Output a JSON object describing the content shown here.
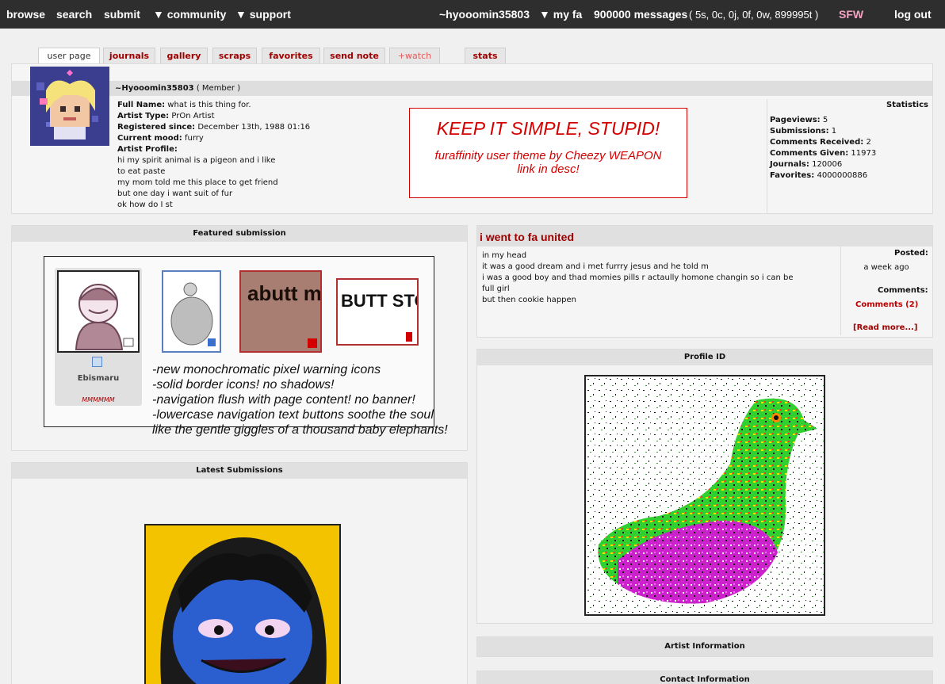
{
  "topnav": {
    "browse": "browse",
    "search": "search",
    "submit": "submit",
    "community": "▼ community",
    "support": "▼ support",
    "username": "~hyooomin35803",
    "myfa": "▼ my fa",
    "messages": "900000 messages",
    "message_counts": "( 5s, 0c, 0j, 0f, 0w, 899995t )",
    "sfw": "SFW",
    "logout": "log out"
  },
  "tabs": [
    {
      "label": "user page"
    },
    {
      "label": "journals"
    },
    {
      "label": "gallery"
    },
    {
      "label": "scraps"
    },
    {
      "label": "favorites"
    },
    {
      "label": "send note"
    },
    {
      "label": "+watch"
    },
    {
      "label": "stats"
    }
  ],
  "profile": {
    "name": "~Hyooomin35803",
    "role": "( Member )",
    "full_name_label": "Full Name:",
    "full_name": "what is this thing for.",
    "artist_type_label": "Artist Type:",
    "artist_type": "PrOn Artist",
    "registered_label": "Registered since:",
    "registered": "December 13th, 1988 01:16",
    "mood_label": "Current mood:",
    "mood": "furry",
    "artist_profile_label": "Artist Profile:",
    "bio": [
      "hi my spirit animal is a pigeon and i like",
      "to eat paste",
      "my mom told me this place to get friend",
      "but one day i want suit of fur",
      "ok how do I st"
    ]
  },
  "kiss_box": {
    "title": "KEEP IT SIMPLE, STUPID!",
    "line1": "furaffinity user theme by Cheezy WEAPON",
    "line2": "link in desc!"
  },
  "stats": {
    "heading": "Statistics",
    "items": [
      {
        "label": "Pageviews:",
        "value": "5"
      },
      {
        "label": "Submissions:",
        "value": "1"
      },
      {
        "label": "Comments Received:",
        "value": "2"
      },
      {
        "label": "Comments Given:",
        "value": "11973"
      },
      {
        "label": "Journals:",
        "value": "120006"
      },
      {
        "label": "Favorites:",
        "value": "4000000886"
      }
    ]
  },
  "featured": {
    "heading": "Featured submission",
    "artist": "Ebismaru",
    "rating_text": "MMMMMM",
    "notes": [
      "-new monochromatic pixel warning icons",
      "-solid border icons! no shadows!",
      "-navigation flush with page content! no banner!",
      "-lowercase navigation text buttons soothe the soul",
      "like the gentle giggles of a thousand baby elephants!"
    ],
    "thumbs": [
      "abutt movie",
      "BUTT STORY"
    ]
  },
  "latest": {
    "heading": "Latest Submissions"
  },
  "journal": {
    "title": "i went to fa united",
    "lines": [
      "in my head",
      "it was a good dream and i met furrry jesus and he told m",
      "i was a good boy and thad momies pills r actaully homone changin so i can be",
      "full girl",
      "but then cookie happen"
    ],
    "posted_label": "Posted:",
    "posted": "a week ago",
    "comments_label": "Comments:",
    "comments_link": "Comments (2)",
    "read_more": "[Read more...]"
  },
  "profile_id": {
    "heading": "Profile ID"
  },
  "artist_info": {
    "heading": "Artist Information"
  },
  "contact_info": {
    "heading": "Contact Information"
  },
  "colors": {
    "topbar": "#2e2e2e",
    "link_red": "#a00000",
    "accent_red": "#d40000",
    "sfw_pink": "#f4a3c2"
  }
}
